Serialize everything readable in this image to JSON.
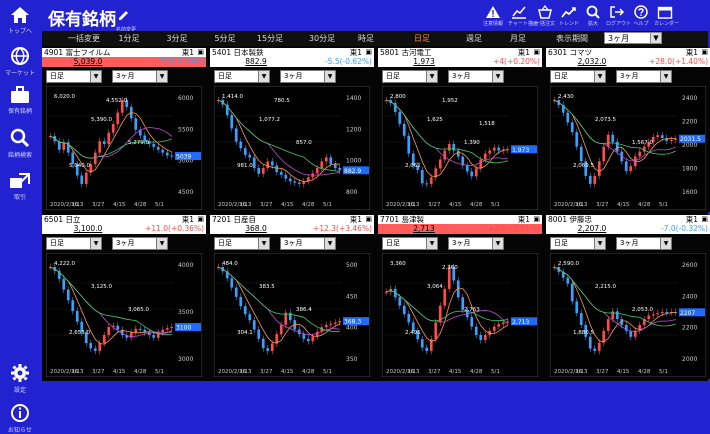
{
  "app": {
    "title": "保有銘柄",
    "edit_label": "名前変更"
  },
  "sidebar": [
    {
      "icon": "home-icon",
      "label": "トップへ"
    },
    {
      "icon": "globe-icon",
      "label": "マーケット"
    },
    {
      "icon": "briefcase-icon",
      "label": "保有銘柄"
    },
    {
      "icon": "search-icon",
      "label": "銘柄検索"
    },
    {
      "icon": "swap-icon",
      "label": "取引"
    },
    {
      "icon": "gear-icon",
      "label": "設定"
    },
    {
      "icon": "info-icon",
      "label": "お知らせ"
    }
  ],
  "toolbar": [
    {
      "icon": "alert-icon",
      "label": "注意情報"
    },
    {
      "icon": "chart-draw-icon",
      "label": "チャート描画"
    },
    {
      "icon": "basket-icon",
      "label": "一括注文"
    },
    {
      "icon": "trend-icon",
      "label": "トレンド"
    },
    {
      "icon": "zoom-icon",
      "label": "拡大"
    },
    {
      "icon": "logout-icon",
      "label": "ログアウト"
    },
    {
      "icon": "help-icon",
      "label": "ヘルプ"
    },
    {
      "icon": "calendar-icon",
      "label": "カレンダー"
    }
  ],
  "tabs": [
    {
      "label": "一括変更",
      "selected": false
    },
    {
      "label": "1分足",
      "selected": false
    },
    {
      "label": "3分足",
      "selected": false
    },
    {
      "label": "5分足",
      "selected": false
    },
    {
      "label": "15分足",
      "selected": false
    },
    {
      "label": "30分足",
      "selected": false
    },
    {
      "label": "時足",
      "selected": false
    },
    {
      "label": "日足",
      "selected": true
    },
    {
      "label": "週足",
      "selected": false
    },
    {
      "label": "月足",
      "selected": false
    }
  ],
  "period": {
    "label": "表示期間",
    "value": "3ヶ月"
  },
  "colors": {
    "up": "#ff4b4b",
    "down": "#3aa0ff",
    "price_up_bg": "#ff5c5c",
    "price_neutral_bg": "#ffffff",
    "accent": "#2222d0",
    "selected_tab": "#ff8a3c"
  },
  "stocks": [
    {
      "name": "4901 富士フイルム",
      "market": "東1",
      "price": "5,039.0",
      "change": "-7.0(-0.14%)",
      "direction": "down",
      "price_bg": "up",
      "timeframe": "日足",
      "range": "3ヶ月",
      "x_labels": [
        "2020/2/26",
        "3/13",
        "3/27",
        "4/15",
        "4/28",
        "5/1"
      ],
      "y_ticks": [
        "6000",
        "5500",
        "5000",
        "4500"
      ],
      "annotations": [
        "6,020.0",
        "5,390.0",
        "5,279.0",
        "5,040.0",
        "4,552.0"
      ],
      "current_tag": "5039",
      "series": [
        5390,
        5300,
        5150,
        5279,
        5100,
        4900,
        4700,
        4552,
        4750,
        4900,
        5100,
        5300,
        5250,
        5450,
        5600,
        5800,
        6020,
        5900,
        5700,
        5500,
        5400,
        5300,
        5250,
        5200,
        5150,
        5100,
        5050,
        5040
      ]
    },
    {
      "name": "5401 日本製鉄",
      "market": "東1",
      "price": "882.9",
      "change": "-5.5(-0.62%)",
      "direction": "down",
      "price_bg": "neutral",
      "timeframe": "日足",
      "range": "3ヶ月",
      "x_labels": [
        "2020/2/26",
        "3/13",
        "3/27",
        "4/15",
        "4/28",
        "5/1"
      ],
      "y_ticks": [
        "1400",
        "1200",
        "1000",
        "800"
      ],
      "annotations": [
        "1,414.0",
        "1,077.2",
        "857.0",
        "981.0",
        "780.5"
      ],
      "current_tag": "882.9",
      "series": [
        1414,
        1380,
        1300,
        1200,
        1100,
        1050,
        1000,
        980,
        900,
        857,
        900,
        950,
        920,
        870,
        850,
        820,
        800,
        790,
        780,
        800,
        830,
        860,
        900,
        950,
        981,
        930,
        900,
        883
      ]
    },
    {
      "name": "5801 古河電工",
      "market": "東1",
      "price": "1,973",
      "change": "+4(+0.20%)",
      "direction": "up",
      "price_bg": "neutral",
      "timeframe": "日足",
      "range": "3ヶ月",
      "x_labels": [
        "2020/2/26",
        "3/13",
        "3/27",
        "4/15",
        "4/28",
        "5/1"
      ],
      "y_ticks": [],
      "annotations": [
        "2,800",
        "1,625",
        "1,390",
        "2,061",
        "1,952",
        "1,518"
      ],
      "current_tag": "1,973",
      "series": [
        2800,
        2750,
        2600,
        2400,
        2200,
        1900,
        1700,
        1625,
        1400,
        1390,
        1500,
        1650,
        1800,
        1950,
        2061,
        1950,
        1850,
        1700,
        1600,
        1518,
        1650,
        1800,
        1900,
        1952,
        2000,
        1950,
        1970,
        1973
      ]
    },
    {
      "name": "6301 コマツ",
      "market": "東1",
      "price": "2,032.0",
      "change": "+28.0(+1.40%)",
      "direction": "up",
      "price_bg": "neutral",
      "timeframe": "日足",
      "range": "3ヶ月",
      "x_labels": [
        "2020/2/26",
        "3/13",
        "3/27",
        "4/15",
        "4/28",
        "5/1"
      ],
      "y_ticks": [
        "2400",
        "2200",
        "2000",
        "1800",
        "1600"
      ],
      "annotations": [
        "2,430",
        "2,073.5",
        "1,567.0",
        "2,069.5"
      ],
      "current_tag": "2031.5",
      "series": [
        2430,
        2380,
        2300,
        2200,
        2100,
        1950,
        1800,
        1650,
        1567,
        1650,
        1800,
        1950,
        2073,
        2000,
        1900,
        1800,
        1700,
        1750,
        1850,
        1900,
        1950,
        2000,
        2050,
        2069,
        2040,
        2010,
        2020,
        2032
      ]
    },
    {
      "name": "6501 日立",
      "market": "東1",
      "price": "3,100.0",
      "change": "+11.0(+0.36%)",
      "direction": "up",
      "price_bg": "neutral",
      "timeframe": "日足",
      "range": "3ヶ月",
      "x_labels": [
        "2020/2/26",
        "3/13",
        "3/27",
        "4/15",
        "4/28",
        "5/1"
      ],
      "y_ticks": [
        "4000",
        "3500",
        "3000"
      ],
      "annotations": [
        "4,222.0",
        "3,125.0",
        "3,065.0",
        "2,653.0"
      ],
      "current_tag": "3100",
      "series": [
        4222,
        4150,
        4000,
        3800,
        3600,
        3400,
        3200,
        3000,
        2800,
        2700,
        2653,
        2800,
        2950,
        3100,
        3125,
        3050,
        2950,
        2900,
        3000,
        3065,
        3050,
        3000,
        2950,
        2900,
        3000,
        3050,
        3080,
        3100
      ]
    },
    {
      "name": "7201 日産自",
      "market": "東1",
      "price": "368.0",
      "change": "+12.3(+3.46%)",
      "direction": "up",
      "price_bg": "neutral",
      "timeframe": "日足",
      "range": "3ヶ月",
      "x_labels": [
        "2020/2/26",
        "3/13",
        "3/27",
        "4/15",
        "4/28",
        "5/1"
      ],
      "y_ticks": [
        "500",
        "450",
        "400",
        "350"
      ],
      "annotations": [
        "484.0",
        "383.5",
        "386.4",
        "304.1"
      ],
      "current_tag": "368.3",
      "series": [
        484,
        475,
        460,
        440,
        420,
        400,
        383,
        370,
        350,
        330,
        310,
        304,
        320,
        340,
        360,
        386,
        370,
        350,
        340,
        330,
        325,
        335,
        345,
        355,
        360,
        362,
        365,
        368
      ]
    },
    {
      "name": "7701 島津製",
      "market": "東1",
      "price": "2,713",
      "change": "+27(+1.01%)",
      "direction": "up",
      "price_bg": "up",
      "timeframe": "日足",
      "range": "3ヶ月",
      "x_labels": [
        "2020/2/26",
        "3/13",
        "3/27",
        "4/15",
        "4/28",
        "5/1"
      ],
      "y_ticks": [],
      "annotations": [
        "3,360",
        "3,064",
        "2,763",
        "2,491",
        "2,360"
      ],
      "current_tag": "2,713",
      "series": [
        3064,
        3100,
        3000,
        2900,
        2800,
        2700,
        2600,
        2500,
        2400,
        2360,
        2500,
        2700,
        2900,
        3100,
        3360,
        3200,
        3000,
        2850,
        2763,
        2650,
        2550,
        2491,
        2550,
        2600,
        2650,
        2680,
        2700,
        2713
      ]
    },
    {
      "name": "8001 伊藤忠",
      "market": "東1",
      "price": "2,207.0",
      "change": "-7.0(-0.32%)",
      "direction": "down",
      "price_bg": "neutral",
      "timeframe": "日足",
      "range": "3ヶ月",
      "x_labels": [
        "2020/2/26",
        "3/13",
        "3/27",
        "4/15",
        "4/28",
        "5/1"
      ],
      "y_ticks": [
        "2600",
        "2400",
        "2200",
        "2000"
      ],
      "annotations": [
        "2,590.0",
        "2,215.0",
        "2,053.0",
        "1,880.5"
      ],
      "current_tag": "2207",
      "series": [
        2590,
        2550,
        2500,
        2450,
        2300,
        2200,
        2100,
        2000,
        1900,
        1880,
        1950,
        2050,
        2150,
        2215,
        2150,
        2100,
        2050,
        2000,
        2053,
        2100,
        2150,
        2180,
        2190,
        2200,
        2210,
        2205,
        2210,
        2207
      ]
    }
  ]
}
